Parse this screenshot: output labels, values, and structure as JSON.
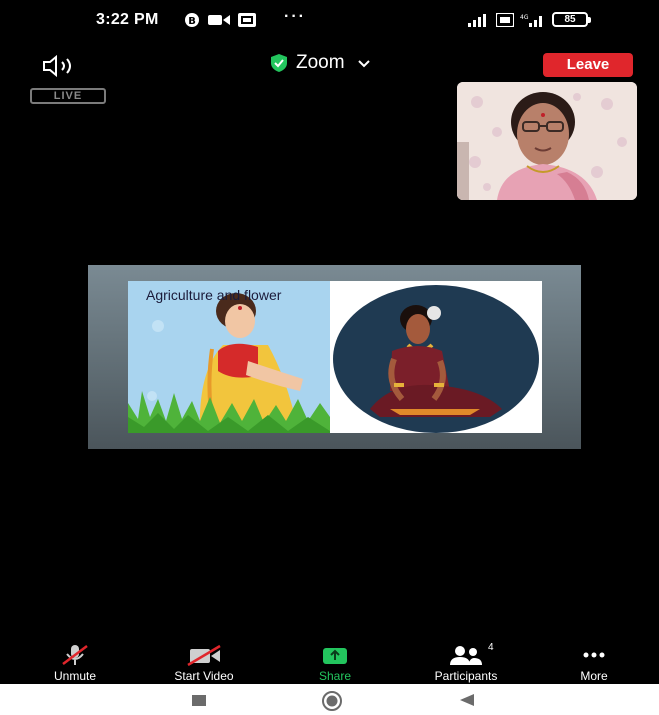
{
  "status_bar": {
    "time": "3:22 PM",
    "dots": "···",
    "battery": "85"
  },
  "header": {
    "speaker_icon": "speaker-icon",
    "title": "Zoom",
    "leave_label": "Leave"
  },
  "live_badge": "LIVE",
  "shared_content": {
    "slide_title": "Agriculture and flower"
  },
  "toolbar": {
    "unmute_label": "Unmute",
    "start_video_label": "Start Video",
    "share_label": "Share",
    "participants_label": "Participants",
    "participants_count": "4",
    "more_label": "More"
  },
  "colors": {
    "leave": "#e0262c",
    "share_accent": "#23c55e",
    "shield": "#23c55e"
  }
}
